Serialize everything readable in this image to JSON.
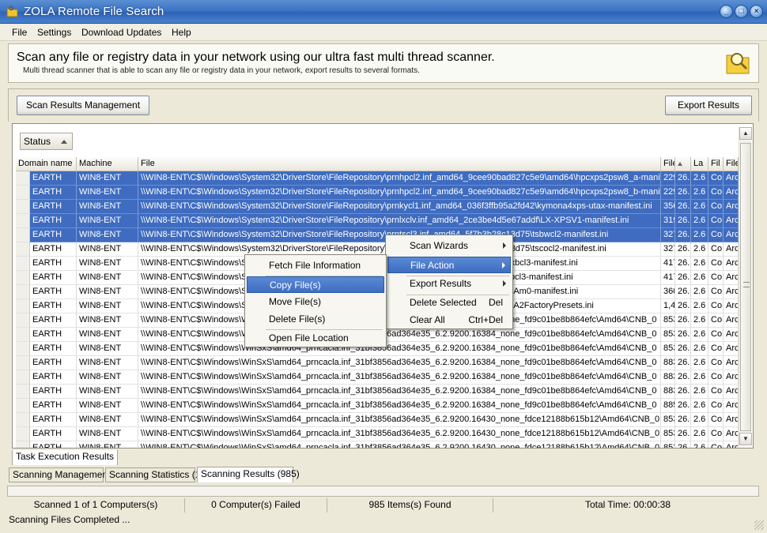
{
  "window": {
    "title": "ZOLA Remote File Search",
    "icon": "folder-key-icon"
  },
  "menu": [
    "File",
    "Settings",
    "Download Updates",
    "Help"
  ],
  "header": {
    "headline": "Scan any file or registry data in your network using our ultra fast multi thread scanner.",
    "subline": "Multi thread scanner that is able to scan any file or registry data in your network, export results to several formats.",
    "icon": "folder-search-icon"
  },
  "toolbar": {
    "scan_results_management": "Scan Results Management",
    "export_results": "Export Results"
  },
  "grid": {
    "group_button": "Status",
    "columns": [
      "Domain name",
      "Machine",
      "File",
      "File",
      "",
      "La",
      "Fil",
      "File"
    ],
    "rows": [
      {
        "selected": true,
        "cells": [
          "EARTH",
          "WIN8-ENT",
          "\\\\WIN8-ENT\\C$\\Windows\\System32\\DriverStore\\FileRepository\\prnhpcl2.inf_amd64_9cee90bad827c5e9\\amd64\\hpcxps2psw8_a-manifest.ini",
          "229",
          "26.",
          "2.6",
          "Co",
          "Arc"
        ]
      },
      {
        "selected": true,
        "cells": [
          "EARTH",
          "WIN8-ENT",
          "\\\\WIN8-ENT\\C$\\Windows\\System32\\DriverStore\\FileRepository\\prnhpcl2.inf_amd64_9cee90bad827c5e9\\amd64\\hpcxps2psw8_b-manifest.ini",
          "229",
          "26.",
          "2.6",
          "Co",
          "Arc"
        ]
      },
      {
        "selected": true,
        "cells": [
          "EARTH",
          "WIN8-ENT",
          "\\\\WIN8-ENT\\C$\\Windows\\System32\\DriverStore\\FileRepository\\prnkycl1.inf_amd64_036f3ffb95a2fd42\\kymona4xps-utax-manifest.ini",
          "356",
          "26.",
          "2.6",
          "Co",
          "Arc"
        ]
      },
      {
        "selected": true,
        "cells": [
          "EARTH",
          "WIN8-ENT",
          "\\\\WIN8-ENT\\C$\\Windows\\System32\\DriverStore\\FileRepository\\prnlxclv.inf_amd64_2ce3be4d5e67addf\\LX-XPSV1-manifest.ini",
          "319",
          "26.",
          "2.6",
          "Co",
          "Arc"
        ]
      },
      {
        "selected": true,
        "cells": [
          "EARTH",
          "WIN8-ENT",
          "\\\\WIN8-ENT\\C$\\Windows\\System32\\DriverStore\\FileRepository\\prntscl3.inf_amd64_5f7b3b28c13d75\\tsbwcl2-manifest.ini",
          "327",
          "26.",
          "2.6",
          "Co",
          "Arc"
        ]
      },
      {
        "selected": false,
        "cells": [
          "EARTH",
          "WIN8-ENT",
          "\\\\WIN8-ENT\\C$\\Windows\\System32\\DriverStore\\FileRepository\\prntscl3.inf_amd64_5f7b3b28c13d75\\tscocl2-manifest.ini",
          "327",
          "26.",
          "2.6",
          "Co",
          "Arc"
        ]
      },
      {
        "selected": false,
        "cells": [
          "EARTH",
          "WIN8-ENT",
          "\\\\WIN8-ENT\\C$\\Windows\\System32\\DriverStore\\FileRepository\\prntscl3.inf_amd64_640573\\tsmxbcl3-manifest.ini",
          "417",
          "26.",
          "2.6",
          "Co",
          "Arc"
        ]
      },
      {
        "selected": false,
        "cells": [
          "EARTH",
          "WIN8-ENT",
          "\\\\WIN8-ENT\\C$\\Windows\\System32\\DriverStore\\FileRepository\\prntscl3.inf_amd64_00d7b\\tsmxbcl3-manifest.ini",
          "417",
          "26.",
          "2.6",
          "Co",
          "Arc"
        ]
      },
      {
        "selected": false,
        "cells": [
          "EARTH",
          "WIN8-ENT",
          "\\\\WIN8-ENT\\C$\\Windows\\System32\\DriverStore\\FileRepository\\prnxrcl1.inf_amd64_5daaf\\xrP6BAm0-manifest.ini",
          "360",
          "26.",
          "2.6",
          "Co",
          "Arc"
        ]
      },
      {
        "selected": false,
        "cells": [
          "EARTH",
          "WIN8-ENT",
          "\\\\WIN8-ENT\\C$\\Windows\\System32\\DriverStore\\FileRepository\\prnxrcl2.inf_amd64_9e279a\\LXAA2FactoryPresets.ini",
          "1,4",
          "26.",
          "2.6",
          "Co",
          "Arc"
        ]
      },
      {
        "selected": false,
        "cells": [
          "EARTH",
          "WIN8-ENT",
          "\\\\WIN8-ENT\\C$\\Windows\\WinSxS\\amd64_prncacla.inf_31bf3856ad364e35_6.2.9200.16384_none_fd9c01be8b864efc\\Amd64\\CNB_0",
          "853",
          "26.",
          "2.6",
          "Co",
          "Arc"
        ]
      },
      {
        "selected": false,
        "cells": [
          "EARTH",
          "WIN8-ENT",
          "\\\\WIN8-ENT\\C$\\Windows\\WinSxS\\amd64_prncacla.inf_31bf3856ad364e35_6.2.9200.16384_none_fd9c01be8b864efc\\Amd64\\CNB_0",
          "853",
          "26.",
          "2.6",
          "Co",
          "Arc"
        ]
      },
      {
        "selected": false,
        "cells": [
          "EARTH",
          "WIN8-ENT",
          "\\\\WIN8-ENT\\C$\\Windows\\WinSxS\\amd64_prncacla.inf_31bf3856ad364e35_6.2.9200.16384_none_fd9c01be8b864efc\\Amd64\\CNB_0",
          "853",
          "26.",
          "2.6",
          "Co",
          "Arc"
        ]
      },
      {
        "selected": false,
        "cells": [
          "EARTH",
          "WIN8-ENT",
          "\\\\WIN8-ENT\\C$\\Windows\\WinSxS\\amd64_prncacla.inf_31bf3856ad364e35_6.2.9200.16384_none_fd9c01be8b864efc\\Amd64\\CNB_0",
          "883",
          "26.",
          "2.6",
          "Co",
          "Arc"
        ]
      },
      {
        "selected": false,
        "cells": [
          "EARTH",
          "WIN8-ENT",
          "\\\\WIN8-ENT\\C$\\Windows\\WinSxS\\amd64_prncacla.inf_31bf3856ad364e35_6.2.9200.16384_none_fd9c01be8b864efc\\Amd64\\CNB_0",
          "883",
          "26.",
          "2.6",
          "Co",
          "Arc"
        ]
      },
      {
        "selected": false,
        "cells": [
          "EARTH",
          "WIN8-ENT",
          "\\\\WIN8-ENT\\C$\\Windows\\WinSxS\\amd64_prncacla.inf_31bf3856ad364e35_6.2.9200.16384_none_fd9c01be8b864efc\\Amd64\\CNB_0",
          "883",
          "26.",
          "2.6",
          "Co",
          "Arc"
        ]
      },
      {
        "selected": false,
        "cells": [
          "EARTH",
          "WIN8-ENT",
          "\\\\WIN8-ENT\\C$\\Windows\\WinSxS\\amd64_prncacla.inf_31bf3856ad364e35_6.2.9200.16384_none_fd9c01be8b864efc\\Amd64\\CNB_0",
          "885",
          "26.",
          "2.6",
          "Co",
          "Arc"
        ]
      },
      {
        "selected": false,
        "cells": [
          "EARTH",
          "WIN8-ENT",
          "\\\\WIN8-ENT\\C$\\Windows\\WinSxS\\amd64_prncacla.inf_31bf3856ad364e35_6.2.9200.16430_none_fdce12188b615b12\\Amd64\\CNB_0",
          "853",
          "26.",
          "2.6",
          "Co",
          "Arc"
        ]
      },
      {
        "selected": false,
        "cells": [
          "EARTH",
          "WIN8-ENT",
          "\\\\WIN8-ENT\\C$\\Windows\\WinSxS\\amd64_prncacla.inf_31bf3856ad364e35_6.2.9200.16430_none_fdce12188b615b12\\Amd64\\CNB_0",
          "853",
          "26.",
          "2.6",
          "Co",
          "Arc"
        ]
      },
      {
        "selected": false,
        "cells": [
          "EARTH",
          "WIN8-ENT",
          "\\\\WIN8-ENT\\C$\\Windows\\WinSxS\\amd64_prncacla.inf_31bf3856ad364e35_6.2.9200.16430_none_fdce12188b615b12\\Amd64\\CNB_0",
          "853",
          "26.",
          "2.6",
          "Co",
          "Arc"
        ]
      }
    ]
  },
  "inner_tab": "Task Execution Results",
  "bottom_tabs": [
    "Scanning Management",
    "Scanning Statistics (1)",
    "Scanning Results (985)"
  ],
  "active_bottom_tab": 2,
  "status": {
    "scanned": "Scanned 1 of 1 Computers(s)",
    "failed": "0 Computer(s) Failed",
    "found": "985 Items(s) Found",
    "total_time": "Total Time: 00:00:38",
    "message": "Scanning Files Completed ..."
  },
  "context_menu": {
    "items": [
      {
        "label": "Scan Wizards",
        "submenu": true
      },
      {
        "label": "File Action",
        "submenu": true,
        "highlighted": true
      },
      {
        "label": "Export Results",
        "submenu": true
      },
      {
        "label": "Delete Selected",
        "shortcut": "Del"
      },
      {
        "label": "Clear All",
        "shortcut": "Ctrl+Del"
      }
    ]
  },
  "file_action_menu": {
    "items": [
      {
        "label": "Fetch File Information"
      },
      {
        "label": "Copy File(s)",
        "highlighted": true
      },
      {
        "label": "Move File(s)"
      },
      {
        "label": "Delete File(s)"
      },
      {
        "label": "Open File Location"
      }
    ]
  },
  "colors": {
    "title_bar": "#3c74c6",
    "selection": "#3f6cc0",
    "menu_highlight": "#4a7bcc"
  }
}
